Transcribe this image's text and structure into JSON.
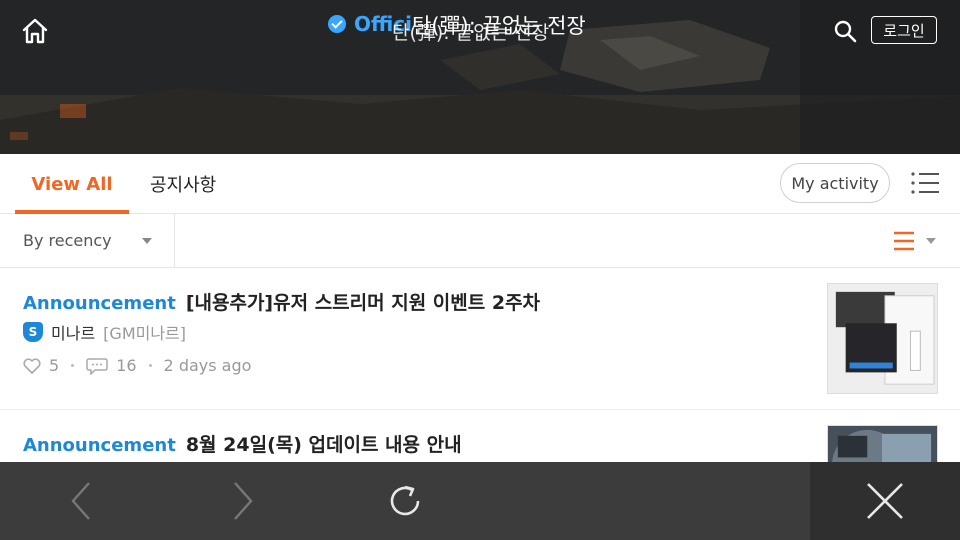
{
  "header": {
    "official_label": "Offici",
    "title_overlay_a": "탄(彈): 끝없는 전장",
    "title_overlay_b": "탄(彈): 끝없는 전장",
    "login_label": "로그인"
  },
  "tabs": [
    {
      "label": "View All",
      "active": true
    },
    {
      "label": "공지사항",
      "active": false
    }
  ],
  "activity_button": "My activity",
  "sort": {
    "selected": "By recency"
  },
  "posts": [
    {
      "category": "Announcement",
      "title": "[내용추가]유저 스트리머 지원 이벤트 2주차",
      "author_badge": "S",
      "author": "미나르",
      "author_tag": "[GM미나르]",
      "likes": "5",
      "comments": "16",
      "time": "2 days ago"
    },
    {
      "category": "Announcement",
      "title": "8월 24일(목) 업데이트 내용 안내"
    }
  ],
  "colors": {
    "accent": "#f26522",
    "link": "#1e88d8",
    "browser_bar": "#3c3c3c"
  },
  "icons": [
    "home-icon",
    "check-icon",
    "search-icon",
    "list-menu-icon",
    "list-view-icon",
    "heart-icon",
    "comment-icon",
    "back-arrow-icon",
    "forward-arrow-icon",
    "reload-icon",
    "close-icon"
  ]
}
